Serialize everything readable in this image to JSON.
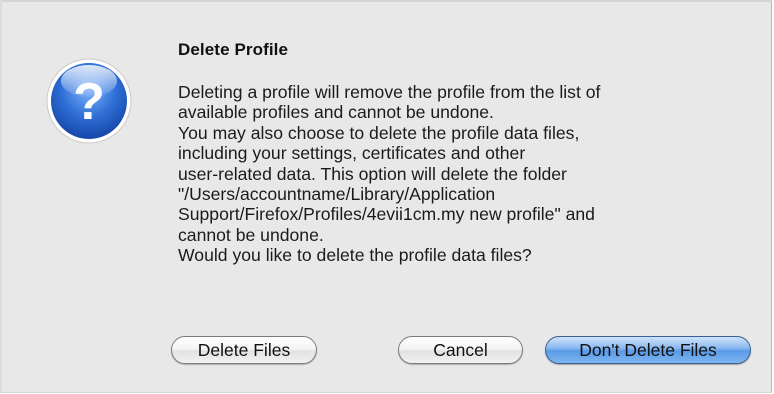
{
  "dialog": {
    "title": "Delete Profile",
    "message_lines": [
      "Deleting a profile will remove the profile from the list of",
      "available profiles and cannot be undone.",
      "You may also choose to delete the profile data files,",
      "including your settings, certificates and other",
      "user-related data. This option will delete the folder",
      "\"/Users/accountname/Library/Application",
      "Support/Firefox/Profiles/4evii1cm.my new profile\" and",
      "cannot be undone.",
      "Would you like to delete the profile data files?"
    ],
    "icon": "question-mark-icon",
    "icon_glyph": "?",
    "buttons": {
      "delete_files": "Delete Files",
      "cancel": "Cancel",
      "dont_delete_files": "Don't Delete Files"
    }
  },
  "colors": {
    "dialog_background": "#e8e8e8",
    "icon_blue": "#2f6fd6",
    "default_button_blue": "#5a9ae6"
  }
}
